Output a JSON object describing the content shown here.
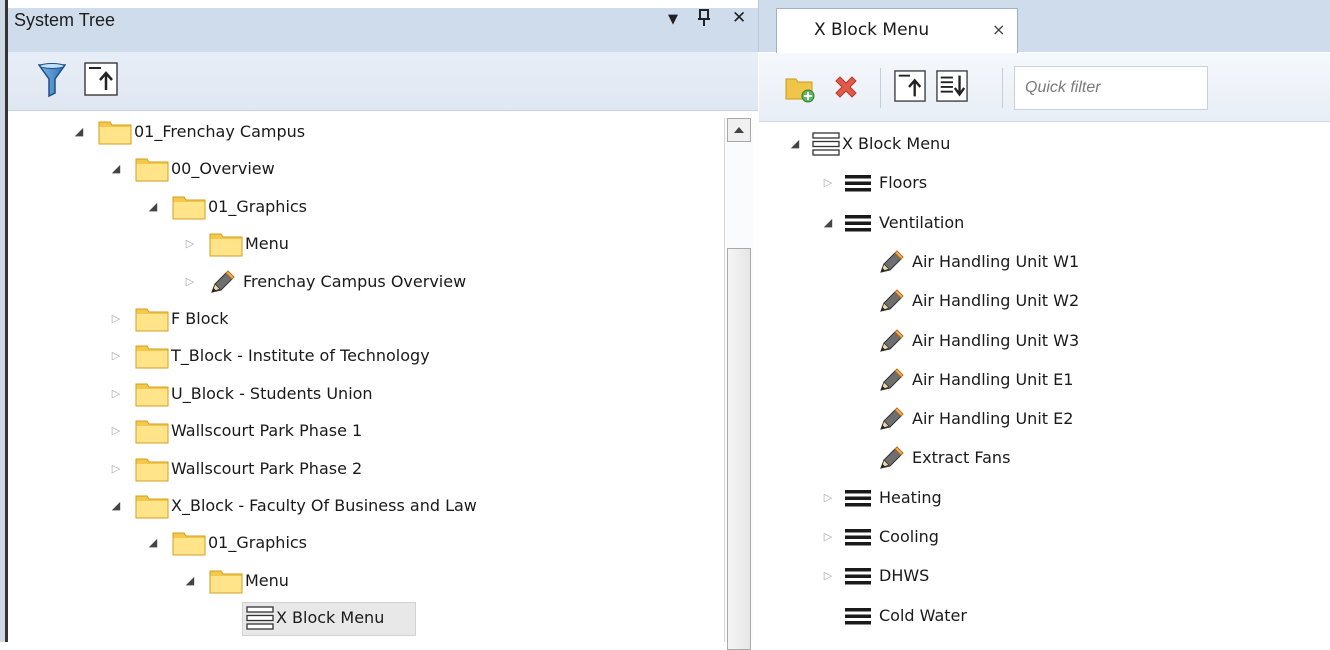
{
  "left_panel": {
    "title": "System Tree",
    "controls": {
      "dropdown": "▼",
      "pin": "ᚂ",
      "close": "✕"
    },
    "toolbar": {
      "filter_icon": "funnel-icon",
      "collapse_icon": "collapse-all-icon"
    },
    "tree": [
      {
        "label": "01_Frenchay Campus",
        "level": 0,
        "state": "expanded",
        "icon": "folder"
      },
      {
        "label": "00_Overview",
        "level": 1,
        "state": "expanded",
        "icon": "folder"
      },
      {
        "label": "01_Graphics",
        "level": 2,
        "state": "expanded",
        "icon": "folder"
      },
      {
        "label": "Menu",
        "level": 3,
        "state": "collapsed",
        "icon": "folder"
      },
      {
        "label": "Frenchay Campus Overview",
        "level": 3,
        "state": "collapsed",
        "icon": "pencil"
      },
      {
        "label": "F Block",
        "level": 1,
        "state": "collapsed",
        "icon": "folder"
      },
      {
        "label": "T_Block - Institute of Technology",
        "level": 1,
        "state": "collapsed",
        "icon": "folder"
      },
      {
        "label": "U_Block - Students Union",
        "level": 1,
        "state": "collapsed",
        "icon": "folder"
      },
      {
        "label": "Wallscourt Park Phase 1",
        "level": 1,
        "state": "collapsed",
        "icon": "folder"
      },
      {
        "label": "Wallscourt Park Phase 2",
        "level": 1,
        "state": "collapsed",
        "icon": "folder"
      },
      {
        "label": "X_Block - Faculty Of Business and Law",
        "level": 1,
        "state": "expanded",
        "icon": "folder"
      },
      {
        "label": "01_Graphics",
        "level": 2,
        "state": "expanded",
        "icon": "folder"
      },
      {
        "label": "Menu",
        "level": 3,
        "state": "expanded",
        "icon": "folder"
      },
      {
        "label": "X Block Menu",
        "level": 4,
        "state": "leaf",
        "icon": "menu-outline",
        "selected": true
      }
    ]
  },
  "right_panel": {
    "tab": {
      "label": "X Block Menu",
      "close": "×"
    },
    "toolbar": {
      "quick_filter_placeholder": "Quick filter"
    },
    "tree": [
      {
        "label": "X Block Menu",
        "level": 0,
        "state": "expanded",
        "icon": "menu-outline"
      },
      {
        "label": "Floors",
        "level": 1,
        "state": "collapsed",
        "icon": "menu"
      },
      {
        "label": "Ventilation",
        "level": 1,
        "state": "expanded",
        "icon": "menu"
      },
      {
        "label": "Air Handling Unit W1",
        "level": 2,
        "state": "leaf",
        "icon": "pencil"
      },
      {
        "label": "Air Handling Unit W2",
        "level": 2,
        "state": "leaf",
        "icon": "pencil"
      },
      {
        "label": "Air Handling Unit W3",
        "level": 2,
        "state": "leaf",
        "icon": "pencil"
      },
      {
        "label": "Air Handling Unit E1",
        "level": 2,
        "state": "leaf",
        "icon": "pencil"
      },
      {
        "label": "Air Handling Unit E2",
        "level": 2,
        "state": "leaf",
        "icon": "pencil"
      },
      {
        "label": "Extract Fans",
        "level": 2,
        "state": "leaf",
        "icon": "pencil"
      },
      {
        "label": "Heating",
        "level": 1,
        "state": "collapsed",
        "icon": "menu"
      },
      {
        "label": "Cooling",
        "level": 1,
        "state": "collapsed",
        "icon": "menu"
      },
      {
        "label": "DHWS",
        "level": 1,
        "state": "collapsed",
        "icon": "menu"
      },
      {
        "label": "Cold Water",
        "level": 1,
        "state": "leaf",
        "icon": "menu"
      }
    ]
  },
  "colors": {
    "header_bg": "#cfdcec",
    "folder": "#f2c13a",
    "delete": "#e05a4a"
  }
}
